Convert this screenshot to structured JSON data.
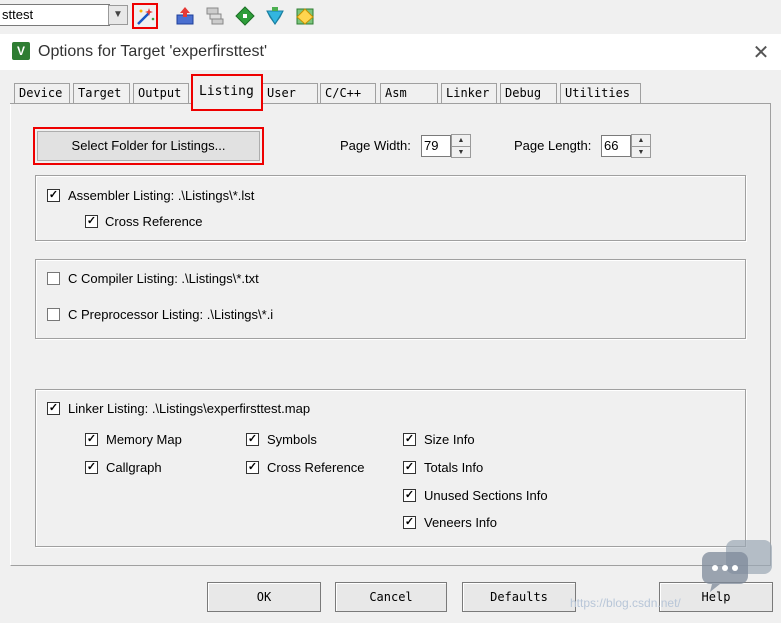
{
  "toolbar": {
    "target_value": "sttest",
    "icons": [
      "magic-wand-icon",
      "load-icon",
      "copy-icon",
      "manage-icon",
      "pack-installer-icon",
      "pack-icon"
    ]
  },
  "dialog": {
    "title": "Options for Target 'experfirsttest'",
    "close_glyph": "✕"
  },
  "tabs": [
    {
      "label": "Device"
    },
    {
      "label": "Target"
    },
    {
      "label": "Output"
    },
    {
      "label": "Listing"
    },
    {
      "label": "User"
    },
    {
      "label": "C/C++"
    },
    {
      "label": "Asm"
    },
    {
      "label": "Linker"
    },
    {
      "label": "Debug"
    },
    {
      "label": "Utilities"
    }
  ],
  "active_tab": "Listing",
  "listing": {
    "select_folder_label": "Select Folder for Listings...",
    "page_width_label": "Page Width:",
    "page_width_value": "79",
    "page_length_label": "Page Length:",
    "page_length_value": "66",
    "assembler_listing": {
      "label": "Assembler Listing:  .\\Listings\\*.lst",
      "checked": true
    },
    "cross_reference": {
      "label": "Cross Reference",
      "checked": true
    },
    "c_compiler_listing": {
      "label": "C Compiler Listing:  .\\Listings\\*.txt",
      "checked": false
    },
    "c_preprocessor_listing": {
      "label": "C Preprocessor Listing:  .\\Listings\\*.i",
      "checked": false
    },
    "linker_listing": {
      "label": "Linker Listing:  .\\Listings\\experfirsttest.map",
      "checked": true
    },
    "linker_options": [
      {
        "label": "Memory Map",
        "checked": true
      },
      {
        "label": "Symbols",
        "checked": true
      },
      {
        "label": "Size Info",
        "checked": true
      },
      {
        "label": "Callgraph",
        "checked": true
      },
      {
        "label": "Cross Reference",
        "checked": true
      },
      {
        "label": "Totals Info",
        "checked": true
      },
      {
        "label": "Unused Sections Info",
        "checked": true
      },
      {
        "label": "Veneers Info",
        "checked": true
      }
    ]
  },
  "buttons": {
    "ok": "OK",
    "cancel": "Cancel",
    "defaults": "Defaults",
    "help": "Help"
  },
  "watermark": "https://blog.csdn.net/",
  "colors": {
    "highlight": "#e00000",
    "dialog_bg": "#f0f0f0",
    "title_icon": "#2e7d32"
  }
}
